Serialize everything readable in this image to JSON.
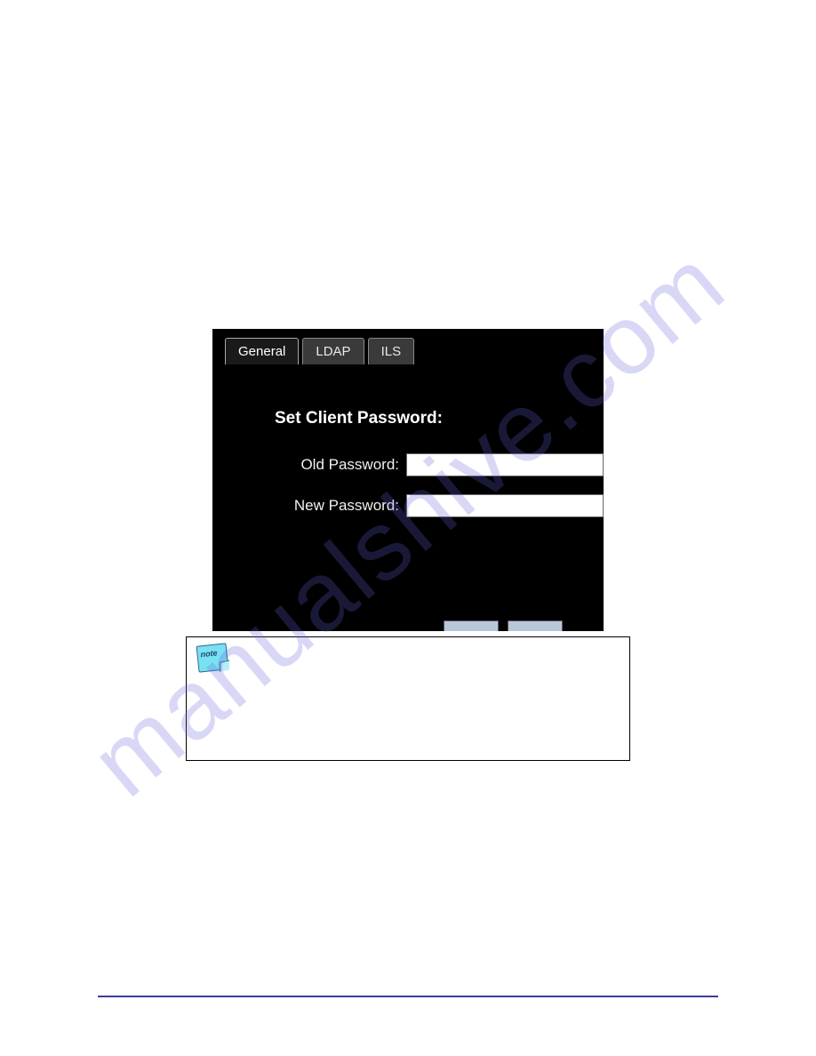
{
  "watermark": "manualshive.com",
  "screenshot": {
    "tabs": [
      "General",
      "LDAP",
      "ILS"
    ],
    "active_tab_index": 0,
    "form_title": "Set Client Password:",
    "fields": [
      {
        "label": "Old Password:"
      },
      {
        "label": "New Password:"
      }
    ]
  },
  "note": {
    "icon_name": "note-icon"
  }
}
